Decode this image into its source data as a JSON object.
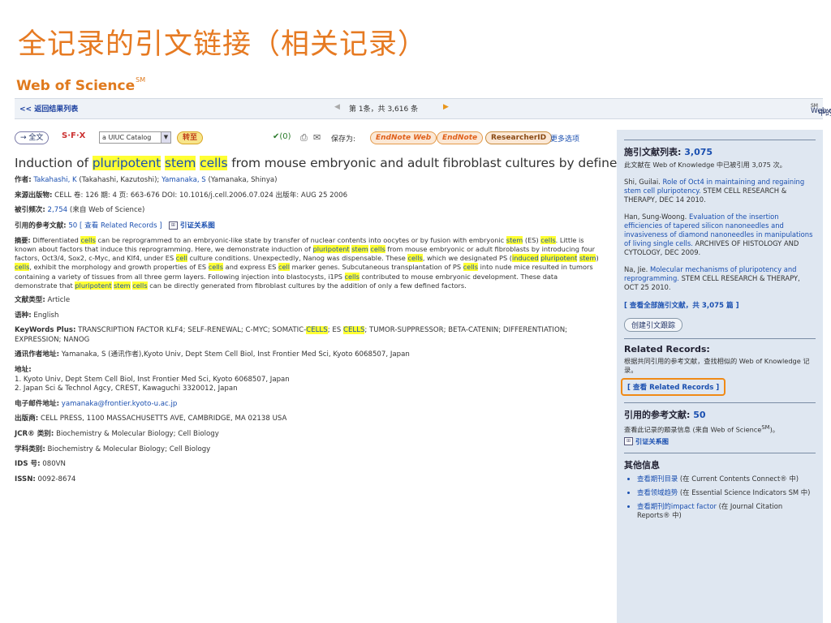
{
  "slide_title": "全记录的引文链接（相关记录）",
  "logo": {
    "text": "Web of Science",
    "sup": "SM"
  },
  "nav": {
    "back": "<< 返回结果列表",
    "pager_text": "第 1条，共 3,616 条",
    "right_pre": "Web of Science",
    "right_sup": "SM",
    "right_post": " 中的记录"
  },
  "toolbar": {
    "fulltext": "→ 全文",
    "sfx": "S·F·X",
    "catalog": "a UIUC Catalog",
    "goto": "转至",
    "marked": "(0)",
    "save_as": "保存为:",
    "endnote_web": "EndNote Web",
    "endnote": "EndNote",
    "researcherid": "ResearcherID",
    "more": "更多选项"
  },
  "article": {
    "title_parts": [
      "Induction of ",
      "pluripotent",
      " ",
      "stem",
      " ",
      "cells",
      " from mouse embryonic and adult fibroblast cultures by defined factors"
    ],
    "authors_label": "作者:",
    "authors_1": "Takahashi, K",
    "authors_1b": " (Takahashi, Kazutoshi); ",
    "authors_2": "Yamanaka, S",
    "authors_2b": " (Yamanaka, Shinya)",
    "source_label": "来源出版物:",
    "source": " CELL  卷: 126  期: 4  页: 663-676  DOI: 10.1016/j.cell.2006.07.024  出版年: AUG 25 2006",
    "cited_label": "被引频次:",
    "cited_count": "2,754",
    "cited_suffix": " (来自 Web of Science)",
    "refs_label": "引用的参考文献:",
    "refs_count": "50",
    "refs_view": "[ 查看  Related Records ]",
    "refs_map": "引证关系图",
    "abstract_label": "摘要:",
    "abstract": [
      " Differentiated ",
      "cells",
      " can be reprogrammed to an embryonic-like state by transfer of nuclear contents into oocytes or by fusion with embryonic ",
      "stem",
      " (ES) ",
      "cells",
      ". Little is known about factors that induce this reprogramming. Here, we demonstrate induction of ",
      "pluripotent",
      " ",
      "stem",
      " ",
      "cells",
      " from mouse embryonic or adult fibroblasts by introducing four factors, Oct3/4, Sox2, c-Myc, and Klf4, under ES ",
      "cell",
      " culture conditions. Unexpectedly, Nanog was dispensable. These ",
      "cells",
      ", which we designated PS (",
      "induced",
      " ",
      "pluripotent",
      " ",
      "stem",
      ") ",
      "cells",
      ", exhibit the morphology and growth properties of ES ",
      "cells",
      " and express ES ",
      "cell",
      " marker genes. Subcutaneous transplantation of PS ",
      "cells",
      " into nude mice resulted in tumors containing a variety of tissues from all three germ layers. Following injection into blastocysts, i1PS ",
      "cells",
      " contributed to mouse embryonic development. These data demonstrate that ",
      "pluripotent",
      " ",
      "stem",
      " ",
      "cells",
      " can be directly generated from fibroblast cultures by the addition of only a few defined factors."
    ],
    "doctype_label": "文献类型:",
    "doctype": " Article",
    "lang_label": "语种:",
    "lang": " English",
    "kw_label": "KeyWords Plus:",
    "kw_a": " TRANSCRIPTION FACTOR KLF4; SELF-RENEWAL; C-MYC; SOMATIC-",
    "kw_hl1": "CELLS",
    "kw_b": "; ES ",
    "kw_hl2": "CELLS",
    "kw_c": "; TUMOR-SUPPRESSOR; BETA-CATENIN; DIFFERENTIATION; EXPRESSION; NANOG",
    "reprint_label": "通讯作者地址:",
    "reprint": " Yamanaka, S (通讯作者),Kyoto Univ, Dept Stem Cell Biol, Inst Frontier Med Sci, Kyoto 6068507, Japan",
    "addr_label": "地址:",
    "addr1": "1. Kyoto Univ, Dept Stem Cell Biol, Inst Frontier Med Sci, Kyoto 6068507, Japan",
    "addr2": "2. Japan Sci & Technol Agcy, CREST, Kawaguchi 3320012, Japan",
    "email_label": "电子邮件地址:",
    "email": "yamanaka@frontier.kyoto-u.ac.jp",
    "publisher_label": "出版商:",
    "publisher": " CELL PRESS, 1100 MASSACHUSETTS AVE, CAMBRIDGE, MA 02138 USA",
    "jcr_label": "JCR® 类别:",
    "jcr": " Biochemistry & Molecular Biology; Cell Biology",
    "subj_label": "学科类别:",
    "subj": " Biochemistry & Molecular Biology; Cell Biology",
    "ids_label": "IDS 号:",
    "ids": " 080VN",
    "issn_label": "ISSN:",
    "issn": " 0092-8674"
  },
  "sidebar": {
    "citing_title": "施引文献列表:",
    "citing_count": "3,075",
    "citing_desc": "此文献在 Web of Knowledge 中已被引用 3,075 次。",
    "citations": [
      {
        "author": "Shi, Guilai. ",
        "title": "Role of Oct4 in maintaining and regaining stem cell pluripotency.",
        "src": " STEM CELL RESEARCH & THERAPY, DEC 14 2010."
      },
      {
        "author": "Han, Sung-Woong. ",
        "title": "Evaluation of the insertion efficiencies of tapered silicon nanoneedles and invasiveness of diamond nanoneedles in manipulations of living single cells.",
        "src": " ARCHIVES OF HISTOLOGY AND CYTOLOGY, DEC 2009."
      },
      {
        "author": "Na, Jie. ",
        "title": "Molecular mechanisms of pluripotency and reprogramming.",
        "src": " STEM CELL RESEARCH & THERAPY, OCT 25 2010."
      }
    ],
    "view_all": "[ 查看全部施引文献，共 3,075 篇 ]",
    "create_alert": "创建引文跟踪",
    "related_title": "Related Records:",
    "related_desc": "根据共同引用的参考文献，查找相似的 Web of Knowledge 记录。",
    "related_link": "[ 查看  Related Records ]",
    "refs_title": "引用的参考文献:",
    "refs_count": "50",
    "refs_desc": "查看此记录的题录信息 (来自 Web of Science",
    "refs_desc_sup": "SM",
    "refs_desc_end": ")。",
    "refs_map": "引证关系图",
    "other_title": "其他信息",
    "other": [
      {
        "a": "查看期刊目录",
        "b": " (在 Current Contents Connect® 中)"
      },
      {
        "a": "查看领域趋势",
        "b": " (在 Essential Science Indicators SM 中)"
      },
      {
        "a": "查看期刊的impact factor",
        "b": " (在 Journal Citation Reports® 中)"
      }
    ]
  }
}
